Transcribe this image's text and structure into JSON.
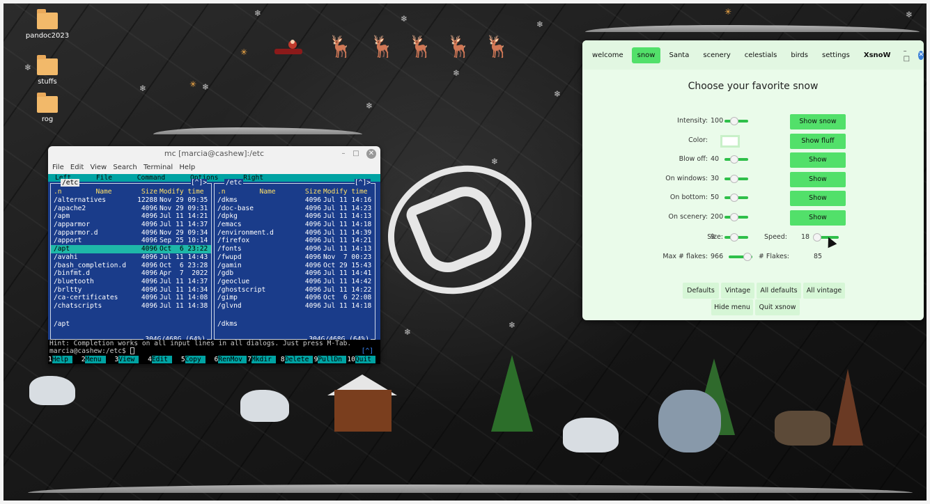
{
  "desktop": {
    "icons": [
      {
        "label": "pandoc2023"
      },
      {
        "label": "stuffs"
      },
      {
        "label": "rog"
      }
    ]
  },
  "terminal": {
    "title": "mc [marcia@cashew]:/etc",
    "menu": [
      "File",
      "Edit",
      "View",
      "Search",
      "Terminal",
      "Help"
    ],
    "mc_menu": [
      "Left",
      "File",
      "Command",
      "Options",
      "Right"
    ],
    "left_panel": {
      "path": "/etc",
      "corner": "[^]>",
      "headers": {
        "n": ".n",
        "name": "Name",
        "size": "Size",
        "time": "Modify time"
      },
      "rows": [
        {
          "name": "/alternatives",
          "size": "12288",
          "time": "Nov 29 09:35"
        },
        {
          "name": "/apache2",
          "size": "4096",
          "time": "Nov 29 09:31"
        },
        {
          "name": "/apm",
          "size": "4096",
          "time": "Jul 11 14:21"
        },
        {
          "name": "/apparmor",
          "size": "4096",
          "time": "Jul 11 14:37"
        },
        {
          "name": "/apparmor.d",
          "size": "4096",
          "time": "Nov 29 09:34"
        },
        {
          "name": "/apport",
          "size": "4096",
          "time": "Sep 25 10:14"
        },
        {
          "name": "/apt",
          "size": "4096",
          "time": "Oct  6 23:22"
        },
        {
          "name": "/avahi",
          "size": "4096",
          "time": "Jul 11 14:43"
        },
        {
          "name": "/bash_completion.d",
          "size": "4096",
          "time": "Oct  6 23:28"
        },
        {
          "name": "/binfmt.d",
          "size": "4096",
          "time": "Apr  7  2022"
        },
        {
          "name": "/bluetooth",
          "size": "4096",
          "time": "Jul 11 14:37"
        },
        {
          "name": "/brltty",
          "size": "4096",
          "time": "Jul 11 14:34"
        },
        {
          "name": "/ca-certificates",
          "size": "4096",
          "time": "Jul 11 14:08"
        },
        {
          "name": "/chatscripts",
          "size": "4096",
          "time": "Jul 11 14:38"
        }
      ],
      "selected_index": 6,
      "footer": "/apt",
      "free": "304G/468G (64%)"
    },
    "right_panel": {
      "path": "/etc",
      "corner": "[^]>",
      "headers": {
        "n": ".n",
        "name": "Name",
        "size": "Size",
        "time": "Modify time"
      },
      "rows": [
        {
          "name": "/dkms",
          "size": "4096",
          "time": "Jul 11 14:16"
        },
        {
          "name": "/doc-base",
          "size": "4096",
          "time": "Jul 11 14:23"
        },
        {
          "name": "/dpkg",
          "size": "4096",
          "time": "Jul 11 14:13"
        },
        {
          "name": "/emacs",
          "size": "4096",
          "time": "Jul 11 14:18"
        },
        {
          "name": "/environment.d",
          "size": "4096",
          "time": "Jul 11 14:39"
        },
        {
          "name": "/firefox",
          "size": "4096",
          "time": "Jul 11 14:21"
        },
        {
          "name": "/fonts",
          "size": "4096",
          "time": "Jul 11 14:13"
        },
        {
          "name": "/fwupd",
          "size": "4096",
          "time": "Nov  7 00:23"
        },
        {
          "name": "/gamin",
          "size": "4096",
          "time": "Oct 29 15:43"
        },
        {
          "name": "/gdb",
          "size": "4096",
          "time": "Jul 11 14:41"
        },
        {
          "name": "/geoclue",
          "size": "4096",
          "time": "Jul 11 14:42"
        },
        {
          "name": "/ghostscript",
          "size": "4096",
          "time": "Jul 11 14:22"
        },
        {
          "name": "/gimp",
          "size": "4096",
          "time": "Oct  6 22:08"
        },
        {
          "name": "/glvnd",
          "size": "4096",
          "time": "Jul 11 14:18"
        }
      ],
      "footer": "/dkms",
      "free": "304G/468G (64%)"
    },
    "hint": "Hint: Completion works on all input lines in all dialogs. Just press M-Tab.",
    "prompt": "marcia@cashew:/etc$",
    "prompt_corner": "[^]",
    "fkeys": [
      {
        "n": "1",
        "label": "Help"
      },
      {
        "n": "2",
        "label": "Menu"
      },
      {
        "n": "3",
        "label": "View"
      },
      {
        "n": "4",
        "label": "Edit"
      },
      {
        "n": "5",
        "label": "Copy"
      },
      {
        "n": "6",
        "label": "RenMov"
      },
      {
        "n": "7",
        "label": "Mkdir"
      },
      {
        "n": "8",
        "label": "Delete"
      },
      {
        "n": "9",
        "label": "PullDn"
      },
      {
        "n": "10",
        "label": "Quit"
      }
    ]
  },
  "xsnow": {
    "tabs": [
      "welcome",
      "snow",
      "Santa",
      "scenery",
      "celestials",
      "birds",
      "settings"
    ],
    "active_tab": "snow",
    "app_name": "XsnoW",
    "window_controls": "–  □",
    "close_glyph": "✕",
    "heading": "Choose your favorite snow",
    "rows": [
      {
        "label": "Intensity:",
        "value": "100",
        "button": "Show snow",
        "level": 0.4
      },
      {
        "label": "Color:",
        "value": "",
        "button": "Show fluff"
      },
      {
        "label": "Blow off:",
        "value": "40",
        "button": "Show",
        "level": 0.4
      },
      {
        "label": "On windows:",
        "value": "30",
        "button": "Show",
        "level": 0.4
      },
      {
        "label": "On bottom:",
        "value": "50",
        "button": "Show",
        "level": 0.4
      },
      {
        "label": "On scenery:",
        "value": "200",
        "button": "Show",
        "level": 0.4
      }
    ],
    "size": {
      "label": "Size:",
      "value": "9",
      "level": 0.4
    },
    "speed": {
      "label": "Speed:",
      "value": "18",
      "level": 0.1
    },
    "max_flakes": {
      "label": "Max # flakes:",
      "value": "966",
      "level": 0.8
    },
    "num_flakes": {
      "label": "# Flakes:",
      "value": "85"
    },
    "buttons_row1": [
      "Defaults",
      "Vintage",
      "All defaults",
      "All vintage"
    ],
    "buttons_row2": [
      "Hide menu",
      "Quit xsnow"
    ]
  },
  "colors": {
    "accent_green": "#52e06a",
    "mc_blue": "#1a3c8a",
    "mc_cyan": "#00a3a3"
  }
}
